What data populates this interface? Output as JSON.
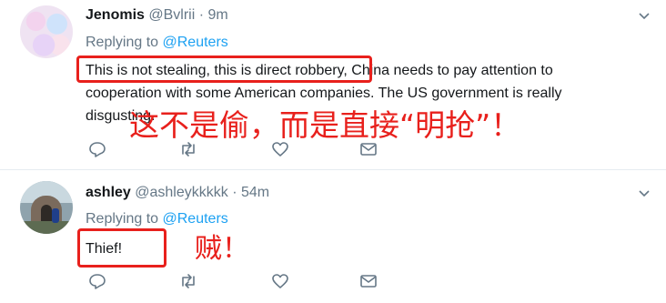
{
  "tweets": [
    {
      "name": "Jenomis",
      "handle": "@Bvlrii",
      "separator": "·",
      "time": "9m",
      "replying_prefix": "Replying to",
      "replying_to": "@Reuters",
      "body_highlight": "This is not stealing, this is direct robbery,",
      "body_rest": " China needs to pay attention to cooperation with some American companies. The US government is really disgusting.",
      "annotation": "这不是偷，而是直接“明抢”！"
    },
    {
      "name": "ashley",
      "handle": "@ashleykkkkk",
      "separator": "·",
      "time": "54m",
      "replying_prefix": "Replying to",
      "replying_to": "@Reuters",
      "body_highlight": "Thief!",
      "annotation": "贼！"
    }
  ],
  "icons": {
    "reply": "reply-icon",
    "retweet": "retweet-icon",
    "like": "heart-icon",
    "dm": "envelope-icon",
    "more": "chevron-down-icon"
  },
  "colors": {
    "accent": "#1da1f2",
    "annotation_red": "#e8201c",
    "muted": "#657786"
  }
}
